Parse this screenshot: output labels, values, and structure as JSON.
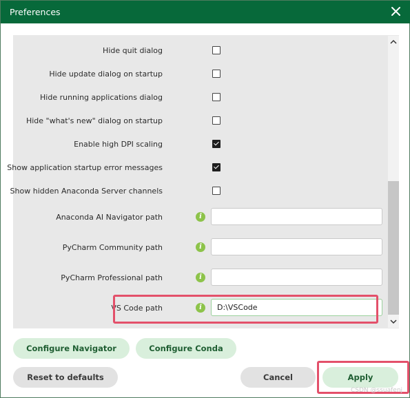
{
  "window": {
    "title": "Preferences"
  },
  "settings": {
    "checkboxes": [
      {
        "label": "Hide quit dialog",
        "checked": false
      },
      {
        "label": "Hide update dialog on startup",
        "checked": false
      },
      {
        "label": "Hide running applications dialog",
        "checked": false
      },
      {
        "label": "Hide \"what's new\" dialog on startup",
        "checked": false
      },
      {
        "label": "Enable high DPI scaling",
        "checked": true
      },
      {
        "label": "Show application startup error messages",
        "checked": true
      },
      {
        "label": "Show hidden Anaconda Server channels",
        "checked": false
      }
    ],
    "paths": [
      {
        "label": "Anaconda AI Navigator path",
        "value": ""
      },
      {
        "label": "PyCharm Community path",
        "value": ""
      },
      {
        "label": "PyCharm Professional path",
        "value": ""
      },
      {
        "label": "VS Code path",
        "value": "D:\\VSCode"
      }
    ]
  },
  "buttons": {
    "configure_navigator": "Configure Navigator",
    "configure_conda": "Configure Conda",
    "reset": "Reset to defaults",
    "cancel": "Cancel",
    "apply": "Apply"
  },
  "icons": {
    "close": "close-icon",
    "info": "info-icon",
    "scroll_up": "chevron-up-icon",
    "scroll_down": "chevron-down-icon"
  },
  "colors": {
    "titlebar": "#07693a",
    "button_green": "#d9efdc",
    "button_gray": "#e2e2e2",
    "highlight": "#e3506a",
    "info_icon": "#8dc34a"
  },
  "watermark": "CSDN @ssuafenj"
}
